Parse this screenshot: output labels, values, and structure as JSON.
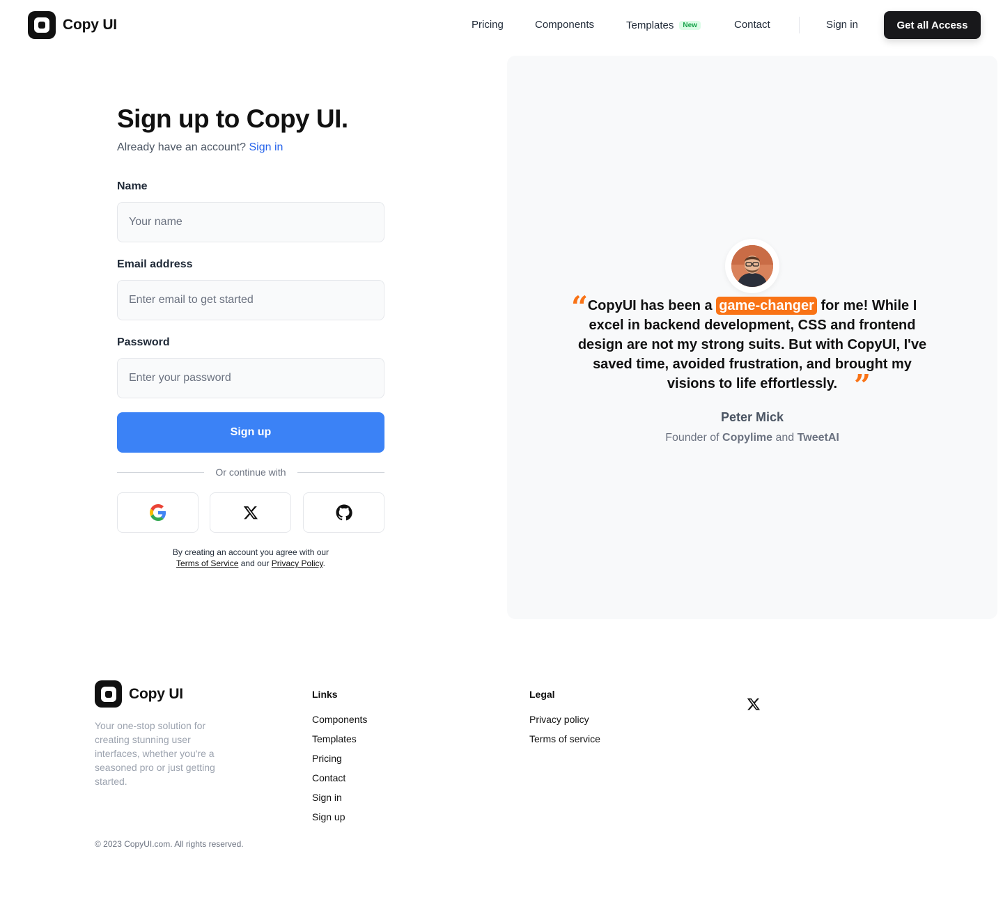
{
  "brand": {
    "name": "Copy UI"
  },
  "nav": {
    "items": [
      "Pricing",
      "Components",
      "Templates",
      "Contact"
    ],
    "templates_badge": "New",
    "sign_in": "Sign in",
    "cta": "Get all Access"
  },
  "form": {
    "title": "Sign up to Copy UI.",
    "already_text": "Already have an account?",
    "already_link": "Sign in",
    "name_label": "Name",
    "name_placeholder": "Your name",
    "email_label": "Email address",
    "email_placeholder": "Enter email to get started",
    "password_label": "Password",
    "password_placeholder": "Enter your password",
    "submit": "Sign up",
    "or_continue": "Or continue with",
    "social": [
      "google-icon",
      "x-icon",
      "github-icon"
    ],
    "terms_pre": "By creating an account you agree with our",
    "terms_link": "Terms of Service",
    "terms_mid": "and our",
    "privacy_link": "Privacy Policy",
    "terms_end": "."
  },
  "testimonial": {
    "quote_before": "CopyUI has been a",
    "quote_highlight": "game-changer",
    "quote_after": "for me! While I excel in backend development, CSS and frontend design are not my strong suits. But with CopyUI, I've saved time, avoided frustration, and brought my visions to life effortlessly.",
    "author": "Peter Mick",
    "role_prefix": "Founder of",
    "company1": "Copylime",
    "role_and": "and",
    "company2": "TweetAI",
    "accent_color": "#f97316"
  },
  "footer": {
    "brand": "Copy UI",
    "tagline": "Your one-stop solution for creating stunning user interfaces, whether you're a seasoned pro or just getting started.",
    "links_heading": "Links",
    "links": [
      "Components",
      "Templates",
      "Pricing",
      "Contact",
      "Sign in",
      "Sign up"
    ],
    "legal_heading": "Legal",
    "legal": [
      "Privacy policy",
      "Terms of service"
    ],
    "copyright": "© 2023 CopyUI.com. All rights reserved."
  }
}
